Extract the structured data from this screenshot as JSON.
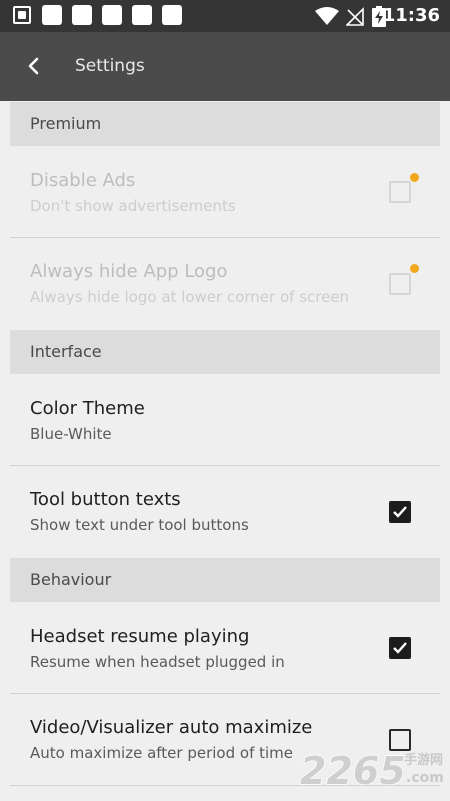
{
  "status_bar": {
    "time": "11:36"
  },
  "toolbar": {
    "title": "Settings",
    "back_icon": "chevron-left-icon"
  },
  "sections": {
    "premium": "Premium",
    "interface": "Interface",
    "behaviour": "Behaviour"
  },
  "items": {
    "disable_ads": {
      "title": "Disable Ads",
      "subtitle": "Don't show advertisements",
      "checked": false,
      "enabled": false
    },
    "hide_logo": {
      "title": "Always hide App Logo",
      "subtitle": "Always hide logo at lower corner of screen",
      "checked": false,
      "enabled": false
    },
    "color_theme": {
      "title": "Color Theme",
      "subtitle": "Blue-White"
    },
    "tool_button_texts": {
      "title": "Tool button texts",
      "subtitle": "Show text under tool buttons",
      "checked": true
    },
    "headset_resume": {
      "title": "Headset resume playing",
      "subtitle": "Resume when headset plugged in",
      "checked": true
    },
    "video_auto_max": {
      "title": "Video/Visualizer auto maximize",
      "subtitle": "Auto maximize after period of time",
      "checked": false
    }
  },
  "colors": {
    "premium_dot": "#f2a81d",
    "toolbar_bg": "#4b4b4b",
    "status_bg": "#353535"
  },
  "watermark": {
    "number": "2265",
    "domain": ".com",
    "chinese": "手游网"
  }
}
